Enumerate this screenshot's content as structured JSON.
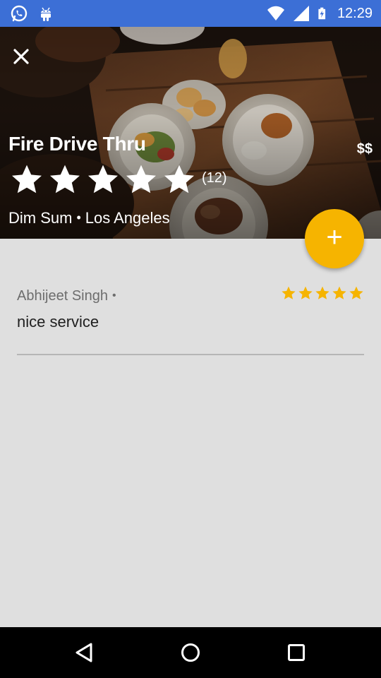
{
  "status_bar": {
    "time": "12:29",
    "left_icons": [
      "whatsapp-icon",
      "android-icon"
    ],
    "right_icons": [
      "wifi-icon",
      "signal-icon",
      "battery-charging-icon"
    ],
    "background_color": "#3c6fd6"
  },
  "restaurant": {
    "name": "Fire Drive Thru",
    "price": "$$",
    "rating": 5,
    "rating_count": "(12)",
    "category": "Dim Sum",
    "separator": "•",
    "city": "Los Angeles"
  },
  "toolbar": {
    "close_icon": "close-icon"
  },
  "fab": {
    "label": "+",
    "color": "#f6b400"
  },
  "reviews": [
    {
      "author": "Abhijeet Singh",
      "separator": "•",
      "rating": 5,
      "text": "nice service",
      "star_color": "#f6b400"
    }
  ],
  "nav_bar": {
    "buttons": [
      "back-icon",
      "home-icon",
      "recents-icon"
    ]
  }
}
